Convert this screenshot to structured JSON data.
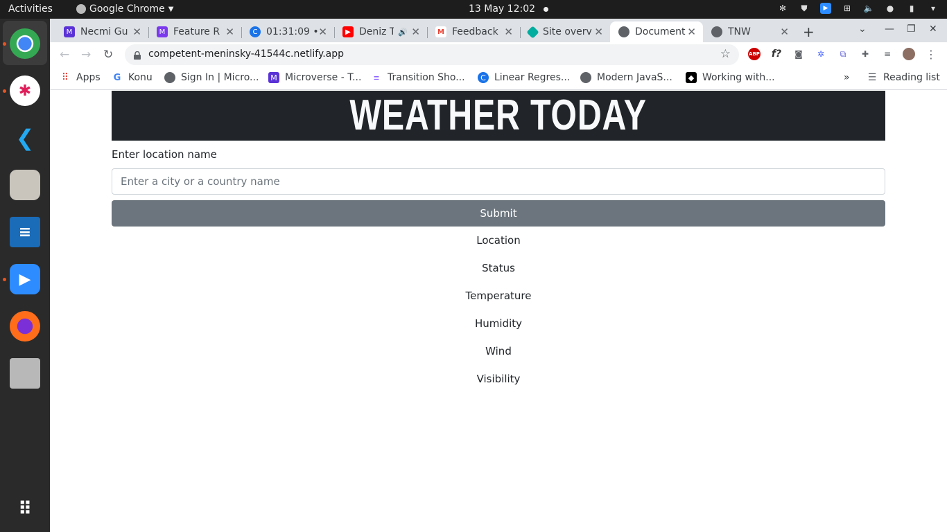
{
  "system_bar": {
    "activities": "Activities",
    "app_name": "Google Chrome",
    "clock": "13 May  12:02"
  },
  "dock": {
    "apps": [
      "chrome-icon",
      "slack-icon",
      "vscode-icon",
      "files-icon",
      "writer-icon",
      "zoom-icon",
      "firefox-icon",
      "sd-card-icon",
      "app-grid-icon"
    ]
  },
  "tabs": [
    {
      "title": "Necmi Gu",
      "color": "#5a32d6"
    },
    {
      "title": "Feature R",
      "color": "#7c3aed"
    },
    {
      "title": "01:31:09 •",
      "color": "#1a73e8"
    },
    {
      "title": "Deniz T",
      "color": "#ff0000"
    },
    {
      "title": "Feedback",
      "color": "#ea4335"
    },
    {
      "title": "Site overv",
      "color": "#00ad9f"
    },
    {
      "title": "Document",
      "color": "#5f6368"
    },
    {
      "title": "TNW",
      "color": "#5f6368"
    }
  ],
  "toolbar": {
    "url": "competent-meninsky-41544c.netlify.app"
  },
  "bookmarks": {
    "apps_label": "Apps",
    "items": [
      "Konu",
      "Sign In | Micro...",
      "Microverse - T...",
      "Transition Sho...",
      "Linear Regres...",
      "Modern JavaS...",
      "Working with..."
    ],
    "more": "»",
    "reading_list": "Reading list"
  },
  "page": {
    "banner_title": "WEATHER TODAY",
    "location_label": "Enter location name",
    "location_placeholder": "Enter a city or a country name",
    "submit_label": "Submit",
    "results": [
      "Location",
      "Status",
      "Temperature",
      "Humidity",
      "Wind",
      "Visibility"
    ]
  }
}
